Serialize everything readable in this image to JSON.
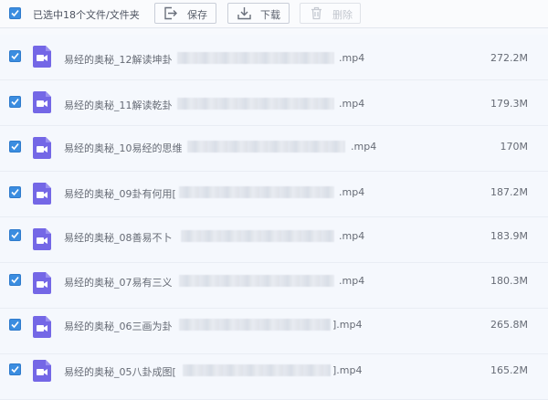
{
  "toolbar": {
    "selected_text": "已选中18个文件/文件夹",
    "save_label": "保存",
    "download_label": "下载",
    "delete_label": "删除"
  },
  "files": [
    {
      "name_prefix": "易经的奥秘_12解读坤卦",
      "ext": ".mp4",
      "size": "272.2M",
      "icon": "video-file-icon"
    },
    {
      "name_prefix": "易经的奥秘_11解读乾卦",
      "ext": ".mp4",
      "size": "179.3M",
      "icon": "video-file-icon"
    },
    {
      "name_prefix": "易经的奥秘_10易经的思维",
      "ext": ".mp4",
      "size": "170M",
      "icon": "video-file-icon"
    },
    {
      "name_prefix": "易经的奥秘_09卦有何用[",
      "ext": ".mp4",
      "size": "187.2M",
      "icon": "video-file-icon"
    },
    {
      "name_prefix": "易经的奥秘_08善易不卜",
      "ext": ".mp4",
      "size": "183.9M",
      "icon": "video-file-icon"
    },
    {
      "name_prefix": "易经的奥秘_07易有三义",
      "ext": ".mp4",
      "size": "180.3M",
      "icon": "video-file-icon"
    },
    {
      "name_prefix": "易经的奥秘_06三画为卦",
      "ext": "].mp4",
      "size": "265.8M",
      "icon": "video-file-icon"
    },
    {
      "name_prefix": "易经的奥秘_05八卦成图[",
      "ext": "].mp4",
      "size": "165.2M",
      "icon": "video-file-icon"
    }
  ],
  "colors": {
    "checkbox": "#3b8de0",
    "video_icon": "#7467e6",
    "background": "#f7f9fd"
  }
}
